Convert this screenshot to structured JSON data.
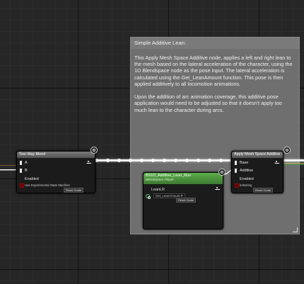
{
  "comment": {
    "title": "Simple Additive Lean:",
    "body": "This Apply Mesh Space Additive node, applies a left and right lean to the mesh based on the lateral acceleration of the character, using the 1D Blendspace node as the pose input. The lateral acceleration is calculated using the Get_LeanAmount function. This pose is then applied additively to all locomotion animations.\n\nUpon the addition of arc animation coverage, this additive pose application would need to be adjusted so that it doesn't apply too much lean to the character during arcs."
  },
  "two_way_blend": {
    "title": "Two Way Blend",
    "pin_a": "A",
    "pin_b": "B",
    "enabled_label": "Enabled",
    "enabled_value": "Use Experimental State Machine",
    "reset_label": "Reset Guide"
  },
  "apply_mesh_space_additive": {
    "title": "Apply Mesh Space Additive",
    "pin_base": "Base",
    "pin_additive": "Additive",
    "enabled_label": "Enabled",
    "enabled_value": "bAltering",
    "reset_label": "Reset Guide"
  },
  "blendspace_node": {
    "title": "BS1D_Additive_Lean_Run",
    "subtitle": "Blendspace Player",
    "lean_label": "LeanLR",
    "lean_value": "Get_LeanAmount.R",
    "reset_label": "Reset Guide"
  },
  "colors": {
    "pose_wire": "#f4f4f4",
    "blendspace_header": "#4a9a3e",
    "comment_bg": "#6f6f6f",
    "bool_pin": "#a00000"
  }
}
